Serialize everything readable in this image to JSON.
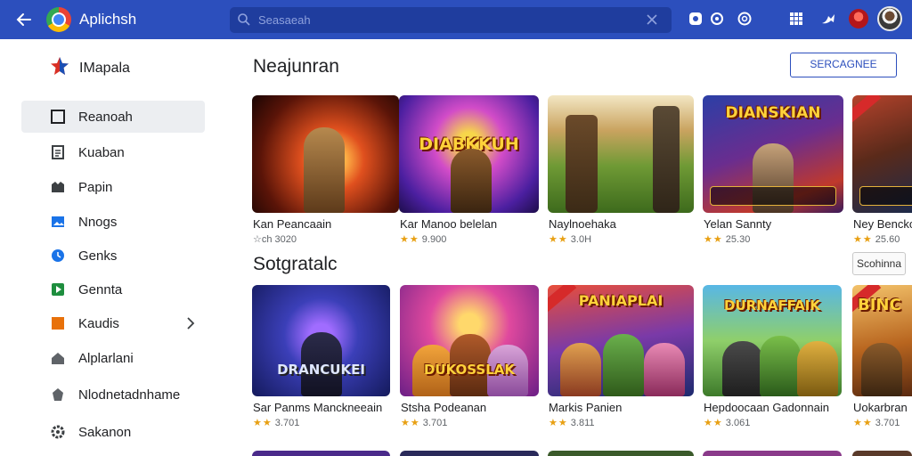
{
  "topbar": {
    "app_title": "Aplichsh",
    "search_placeholder": "Seasaeah",
    "icons": [
      "back-arrow-icon",
      "chrome-logo-icon",
      "search-icon",
      "close-icon",
      "share-icon",
      "settings-icon",
      "account-icon",
      "apps-grid-icon",
      "send-icon"
    ],
    "accent_color": "#2c4fbd"
  },
  "sidebar": {
    "brand": "IMapalа",
    "items": [
      {
        "label": "Reanoah",
        "icon": "square-icon",
        "active": true
      },
      {
        "label": "Kuaban",
        "icon": "document-icon"
      },
      {
        "label": "Papin",
        "icon": "inbox-icon"
      },
      {
        "label": "Nnogs",
        "icon": "image-icon"
      },
      {
        "label": "Genks",
        "icon": "circle-icon"
      },
      {
        "label": "Gennta",
        "icon": "play-icon"
      },
      {
        "label": "Kaudis",
        "icon": "orange-square-icon",
        "has_submenu": true
      },
      {
        "label": "Alplarlani",
        "icon": "home-icon"
      },
      {
        "label": "Nlodnetadnhame",
        "icon": "shield-icon"
      },
      {
        "label": "Sakanon",
        "icon": "gear-icon"
      }
    ]
  },
  "sections": [
    {
      "title": "Neajunran",
      "action": "SERCAGNEE",
      "cards": [
        {
          "title": "Kan Peancaain",
          "rating_text": "☆ch 3020",
          "stars": 0
        },
        {
          "title": "Kar Manoo belelan",
          "rating_text": "9.900",
          "stars": 2,
          "logo": "DIABKKUH"
        },
        {
          "title": "Naylnoehaka",
          "rating_text": "3.0H",
          "stars": 2
        },
        {
          "title": "Yelan Sannty",
          "rating_text": "25.30",
          "stars": 2,
          "logo": "DIANSKIAN"
        },
        {
          "title": "Ney Bencko",
          "rating_text": "25.60",
          "stars": 2
        }
      ]
    },
    {
      "title": "Sotgratalc",
      "action": "Scohinna",
      "cards": [
        {
          "title": "Sar Panms Manckneeain",
          "rating_text": "3.701",
          "stars": 2,
          "logo": "DRANCUKEI"
        },
        {
          "title": "Stsha Podeanan",
          "rating_text": "3.701",
          "stars": 2,
          "logo": "DUKOSSLAK"
        },
        {
          "title": "Markis Panien",
          "rating_text": "3.811",
          "stars": 2,
          "logo": "PANIAPLAI"
        },
        {
          "title": "Hepdoocaan Gadonnain",
          "rating_text": "3.061",
          "stars": 2,
          "logo": "DURNAFFAIK"
        },
        {
          "title": "Uokarbran",
          "rating_text": "3.701",
          "stars": 2,
          "logo": "BINC"
        }
      ]
    }
  ]
}
